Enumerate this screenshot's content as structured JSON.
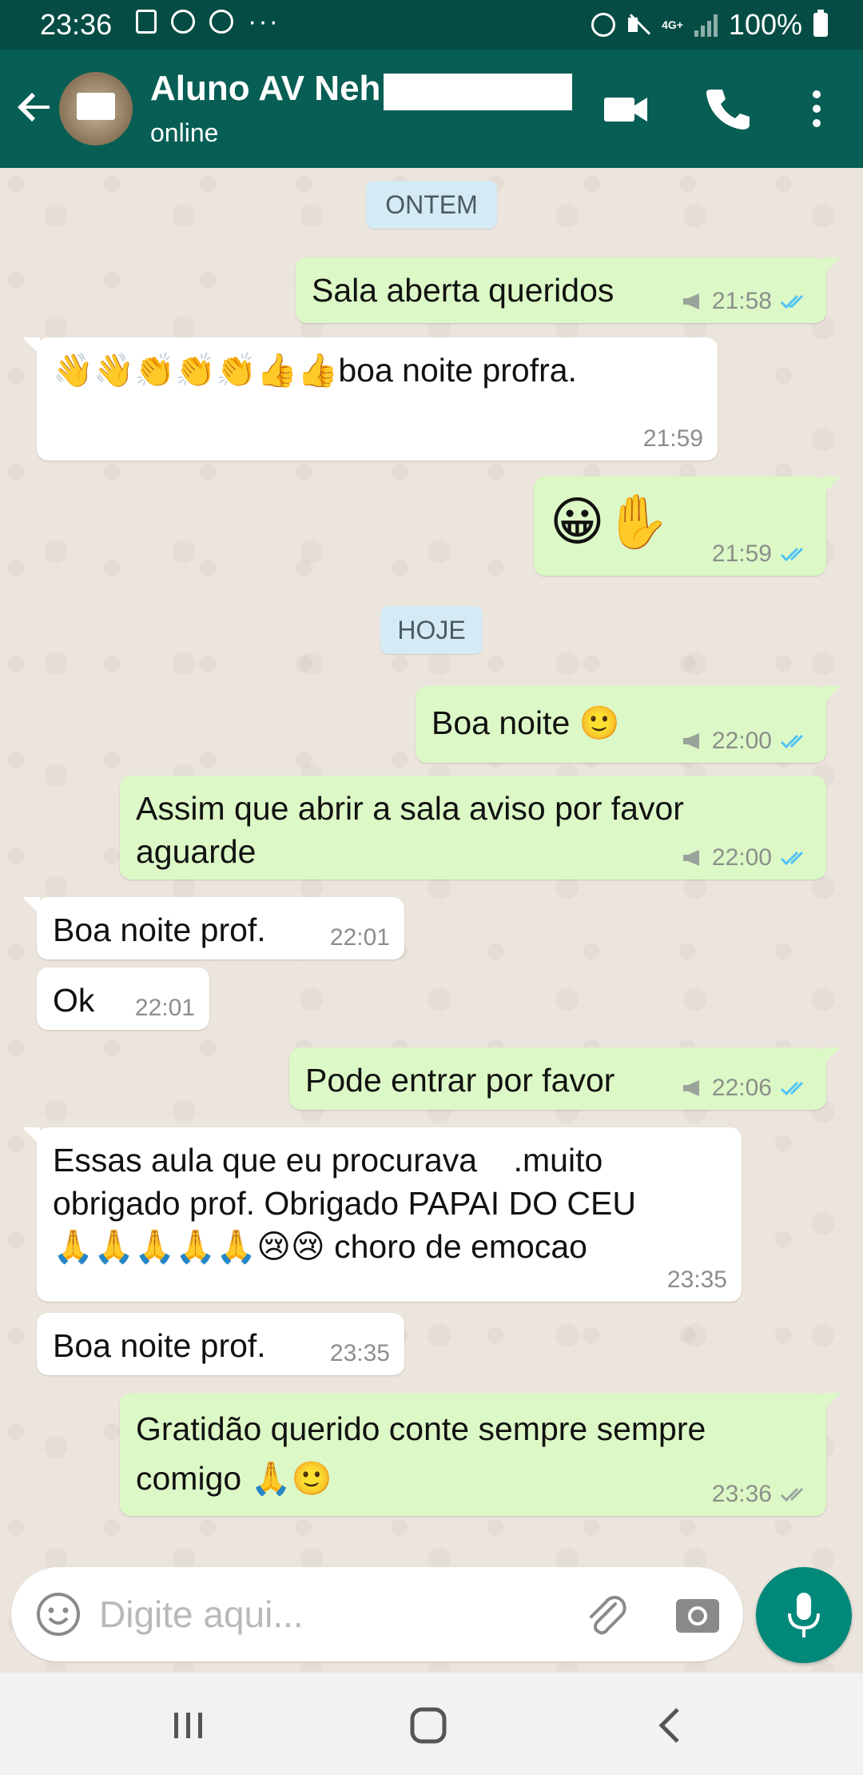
{
  "status_bar": {
    "time": "23:36",
    "network": "4G+",
    "battery": "100%"
  },
  "header": {
    "contact_name": "Aluno AV Neh",
    "status": "online",
    "icons": [
      "back-arrow-icon",
      "video-call-icon",
      "phone-icon",
      "more-vert-icon"
    ]
  },
  "chat": {
    "date_yesterday": "ONTEM",
    "date_today": "HOJE",
    "messages": [
      {
        "dir": "out",
        "text": "Sala aberta queridos",
        "time": "21:58",
        "broadcast": true,
        "ticks": "read"
      },
      {
        "dir": "in",
        "text": "👋👋👏👏👏👍👍boa noite profra.",
        "time": "21:59"
      },
      {
        "dir": "out",
        "text": "😀✋",
        "time": "21:59",
        "ticks": "read"
      },
      {
        "dir": "out",
        "text": "Boa noite 🙂",
        "time": "22:00",
        "broadcast": true,
        "ticks": "read"
      },
      {
        "dir": "out",
        "text": "Assim que abrir a sala aviso por favor\naguarde",
        "time": "22:00",
        "broadcast": true,
        "ticks": "read"
      },
      {
        "dir": "in",
        "text": "Boa noite prof.",
        "time": "22:01"
      },
      {
        "dir": "in",
        "text": "Ok",
        "time": "22:01"
      },
      {
        "dir": "out",
        "text": "Pode entrar por favor",
        "time": "22:06",
        "broadcast": true,
        "ticks": "read"
      },
      {
        "dir": "in",
        "text": "Essas aula que eu procurava    .muito\nobrigado prof. Obrigado PAPAI DO CEU\n🙏🙏🙏🙏🙏😢😢 choro de emocao",
        "time": "23:35"
      },
      {
        "dir": "in",
        "text": "Boa noite prof.",
        "time": "23:35"
      },
      {
        "dir": "out",
        "text": "Gratidão querido conte sempre sempre\ncomigo 🙏🙂",
        "time": "23:36",
        "ticks": "delivered"
      }
    ]
  },
  "input": {
    "placeholder": "Digite aqui..."
  },
  "colors": {
    "header": "#075e54",
    "status_bar": "#054d44",
    "outgoing_bubble": "#dcf8c6",
    "incoming_bubble": "#ffffff",
    "read_tick": "#4fc3f7",
    "mic_button": "#00897b"
  }
}
